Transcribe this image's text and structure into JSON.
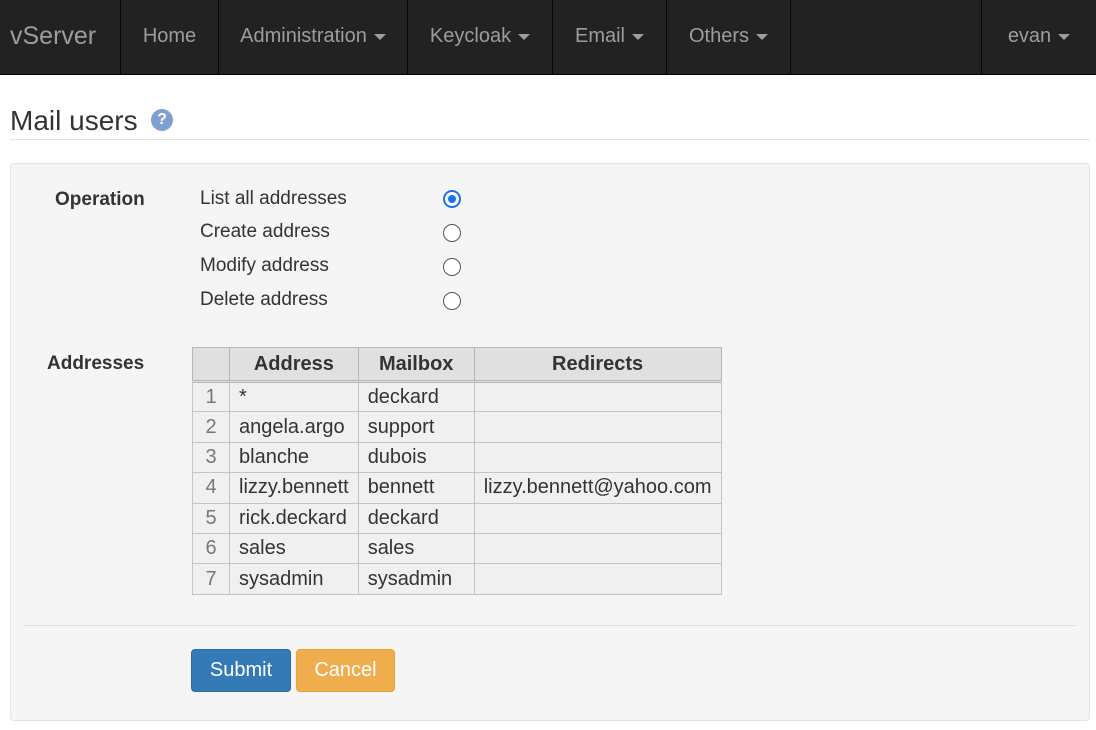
{
  "navbar": {
    "brand": "vServer",
    "items": [
      {
        "label": "Home",
        "dropdown": false
      },
      {
        "label": "Administration",
        "dropdown": true
      },
      {
        "label": "Keycloak",
        "dropdown": true
      },
      {
        "label": "Email",
        "dropdown": true
      },
      {
        "label": "Others",
        "dropdown": true
      }
    ],
    "user": {
      "label": "evan",
      "dropdown": true
    }
  },
  "page": {
    "title": "Mail users",
    "help_icon": "?"
  },
  "form": {
    "operation_label": "Operation",
    "operations": [
      {
        "label": "List all addresses",
        "checked": true
      },
      {
        "label": "Create address",
        "checked": false
      },
      {
        "label": "Modify address",
        "checked": false
      },
      {
        "label": "Delete address",
        "checked": false
      }
    ],
    "addresses_label": "Addresses",
    "table": {
      "columns": [
        "Address",
        "Mailbox",
        "Redirects"
      ],
      "rows": [
        {
          "num": "1",
          "address": "*",
          "mailbox": "deckard",
          "redirects": ""
        },
        {
          "num": "2",
          "address": "angela.argo",
          "mailbox": "support",
          "redirects": ""
        },
        {
          "num": "3",
          "address": "blanche",
          "mailbox": "dubois",
          "redirects": ""
        },
        {
          "num": "4",
          "address": "lizzy.bennett",
          "mailbox": "bennett",
          "redirects": "lizzy.bennett@yahoo.com"
        },
        {
          "num": "5",
          "address": "rick.deckard",
          "mailbox": "deckard",
          "redirects": ""
        },
        {
          "num": "6",
          "address": "sales",
          "mailbox": "sales",
          "redirects": ""
        },
        {
          "num": "7",
          "address": "sysadmin",
          "mailbox": "sysadmin",
          "redirects": ""
        }
      ]
    },
    "submit_label": "Submit",
    "cancel_label": "Cancel"
  },
  "colors": {
    "navbar_bg": "#222222",
    "submit": "#337ab7",
    "cancel": "#f0ad4e",
    "radio_checked": "#1a73e8"
  }
}
